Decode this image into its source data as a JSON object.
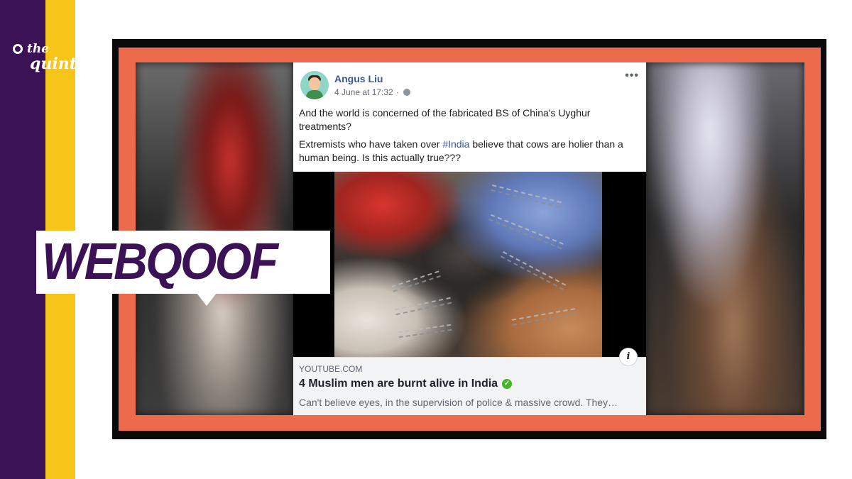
{
  "brand": {
    "logo_line1": "the",
    "logo_line2": "quint",
    "stamp": "WEBQOOF",
    "colors": {
      "purple": "#3b1256",
      "yellow": "#f7c51a",
      "frame_orange": "#ee6a4d"
    }
  },
  "post": {
    "author": "Angus Liu",
    "timestamp": "4 June at 17:32",
    "dot": "·",
    "visibility_icon": "globe-icon",
    "more_label": "•••",
    "text_1": "And the world is concerned of the fabricated BS of China's Uyghur treatments?",
    "text_2_before": "Extremists who have taken over ",
    "hashtag": "#India",
    "text_2_after": " believe that cows are holier than a human being. Is this actually true???",
    "info_label": "i",
    "link": {
      "domain": "YOUTUBE.COM",
      "title": "4 Muslim men are burnt alive in India",
      "verified_icon": "check-circle-icon",
      "description": "Can't believe eyes, in the supervision of police & massive crowd. They…"
    }
  }
}
